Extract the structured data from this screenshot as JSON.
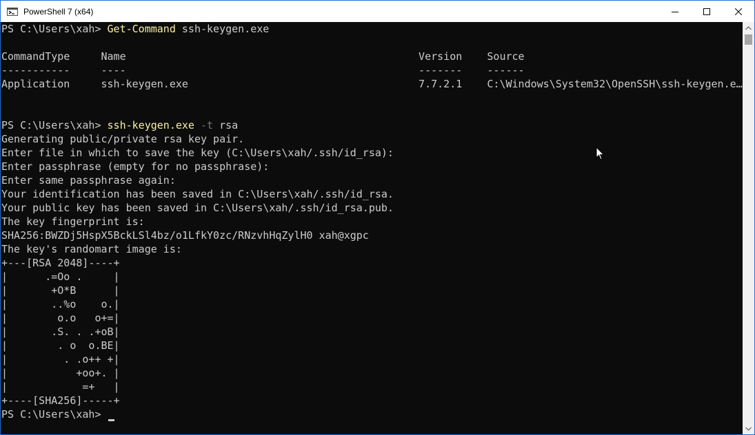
{
  "window": {
    "title": "PowerShell 7 (x64)",
    "minimize_icon": "minimize-icon",
    "maximize_icon": "maximize-icon",
    "close_icon": "close-icon"
  },
  "terminal": {
    "colors": {
      "background": "#0c0c0c",
      "text": "#cccccc",
      "command": "#f9f1a5",
      "parameter": "#767676"
    },
    "prompt": "PS C:\\Users\\xah> ",
    "session1": {
      "command": "Get-Command",
      "argument": " ssh-keygen.exe"
    },
    "table": {
      "header": "CommandType     Name                                               Version    Source",
      "separator": "-----------     ----                                               -------    ------",
      "row": "Application     ssh-keygen.exe                                     7.7.2.1    C:\\Windows\\System32\\OpenSSH\\ssh-keygen.e…"
    },
    "session2": {
      "command": "ssh-keygen.exe",
      "parameter": " -t",
      "argument": " rsa"
    },
    "output": [
      "Generating public/private rsa key pair.",
      "Enter file in which to save the key (C:\\Users\\xah/.ssh/id_rsa):",
      "Enter passphrase (empty for no passphrase):",
      "Enter same passphrase again:",
      "Your identification has been saved in C:\\Users\\xah/.ssh/id_rsa.",
      "Your public key has been saved in C:\\Users\\xah/.ssh/id_rsa.pub.",
      "The key fingerprint is:",
      "SHA256:BWZDj5HspX5BckLSl4bz/o1LfkY0zc/RNzvhHqZylH0 xah@xgpc",
      "The key's randomart image is:",
      "+---[RSA 2048]----+",
      "|      .=Oo .     |",
      "|       +O*B      |",
      "|       ..%o    o.|",
      "|        o.o   o+=|",
      "|       .S. . .+oB|",
      "|        . o  o.BE|",
      "|         . .o++ +|",
      "|           +oo+. |",
      "|            =+   |",
      "+----[SHA256]-----+"
    ]
  },
  "scrollbar": {
    "up_icon": "scroll-up-arrow-icon",
    "down_icon": "scroll-down-arrow-icon"
  }
}
